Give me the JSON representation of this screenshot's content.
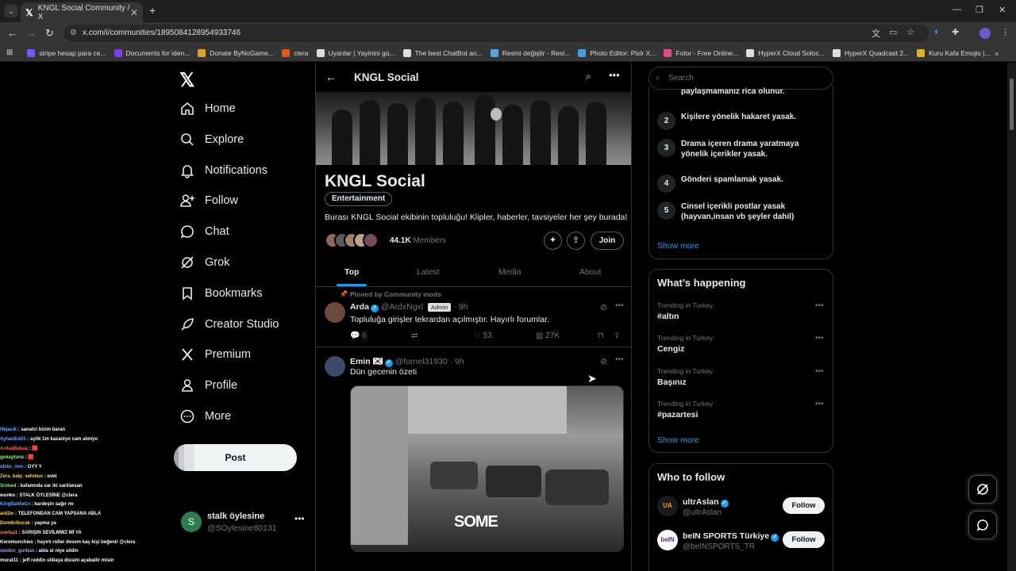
{
  "browser": {
    "tab_title": "KNGL Social Community / X",
    "url": "x.com/i/communities/1895084128954933746",
    "bookmarks": [
      {
        "label": "stripe hesap para ce...",
        "color": "#6a5cff"
      },
      {
        "label": "Documents for iden...",
        "color": "#7b3fe4"
      },
      {
        "label": "Donate ByNoGame...",
        "color": "#e0a030"
      },
      {
        "label": "clera",
        "color": "#e05a20"
      },
      {
        "label": "Uyanlar | Yayinini gü...",
        "color": "#dddddd"
      },
      {
        "label": "The best ChatBot an...",
        "color": "#dddddd"
      },
      {
        "label": "Resmi değiştir - Resi...",
        "color": "#5aa0e0"
      },
      {
        "label": "Photo Editor: Pixlr X...",
        "color": "#3fa0e0"
      },
      {
        "label": "Fotor - Free Online...",
        "color": "#e04a8a"
      },
      {
        "label": "HyperX Cloud Soloc...",
        "color": "#dddddd"
      },
      {
        "label": "HyperX Quadcast 2...",
        "color": "#dddddd"
      },
      {
        "label": "Kuru Kafa Emojis |...",
        "color": "#e0b030"
      }
    ]
  },
  "sidebar": {
    "items": [
      {
        "label": "Home",
        "icon": "home-icon"
      },
      {
        "label": "Explore",
        "icon": "search-icon"
      },
      {
        "label": "Notifications",
        "icon": "bell-icon"
      },
      {
        "label": "Follow",
        "icon": "add-person-icon"
      },
      {
        "label": "Chat",
        "icon": "chat-icon"
      },
      {
        "label": "Grok",
        "icon": "grok-icon"
      },
      {
        "label": "Bookmarks",
        "icon": "bookmark-icon"
      },
      {
        "label": "Creator Studio",
        "icon": "rocket-icon"
      },
      {
        "label": "Premium",
        "icon": "x-logo-icon"
      },
      {
        "label": "Profile",
        "icon": "person-icon"
      },
      {
        "label": "More",
        "icon": "more-circle-icon"
      }
    ],
    "post_label": "Post",
    "account": {
      "initial": "S",
      "name": "stalk öylesine",
      "handle": "@SOylesine80131"
    }
  },
  "chat_overlay": [
    {
      "user": "Hejacik",
      "color": "#5ab0ff",
      "msg": " : sanatci bizim baran"
    },
    {
      "user": "AyhanEdit1",
      "color": "#6ea6ff",
      "msg": " : aylik 1m kazaniyo cam almiyo"
    },
    {
      "user": "ArdaaBabaa",
      "color": "#ff5a5a",
      "msg": " : 🟥"
    },
    {
      "user": "gokaytuna",
      "color": "#7aff7a",
      "msg": " : 🟥"
    },
    {
      "user": "obito_rinn",
      "color": "#6ea6ff",
      "msg": " : OYY Y"
    },
    {
      "user": "Zera_kalp_sehmus",
      "color": "#ffd24a",
      "msg": " : evet"
    },
    {
      "user": "Srimed",
      "color": "#7aff7a",
      "msg": " : kafamnda var iki sarilsesan"
    },
    {
      "user": "wunko",
      "color": "#ffffff",
      "msg": " : STALK ÖYLESİNE @clera"
    },
    {
      "user": "KingBaldw1n",
      "color": "#6ea6ff",
      "msg": " : kardeşin sağır mı"
    },
    {
      "user": "ard2w",
      "color": "#ffd24a",
      "msg": " : TELEFONDAN CAM YAPSANA ABLA"
    },
    {
      "user": "Dom6cIburak",
      "color": "#ffd24a",
      "msg": " : yapma ya"
    },
    {
      "user": "ssefaa1",
      "color": "#ff8a4a",
      "msg": " : SARIŞIN SEVİLMWZ Mİ YA"
    },
    {
      "user": "Keromunchies",
      "color": "#ffffff",
      "msg": " : hayırlı roller desem kaç kişi beğenir @clera"
    },
    {
      "user": "umdov_gurban",
      "color": "#c78aff",
      "msg": " : abla st niye sildin"
    },
    {
      "user": "murat11",
      "color": "#ffffff",
      "msg": " : jeff reddin stillaya dissini açabailir misin"
    }
  ],
  "community": {
    "header_title": "KNGL Social",
    "name": "KNGL Social",
    "category": "Entertainment",
    "description": "Burası KNGL Social ekibinin topluluğu! Klipler, haberler, tavsiyeler her şey burada!",
    "members_count": "44.1K",
    "members_label": "Members",
    "join_label": "Join",
    "tabs": [
      "Top",
      "Latest",
      "Media",
      "About"
    ]
  },
  "posts": [
    {
      "pinned_label": "Pinned by Community mods",
      "name": "Arda",
      "handle": "@ArdxNgxl",
      "badge": "Admin",
      "time": "· 9h",
      "text": "Topluluğa girişler tekrardan açılmıştır. Hayırlı forumlar.",
      "replies": "6",
      "likes": "53",
      "views": "27K"
    },
    {
      "name": "Emin 🇰🇷",
      "handle": "@fornel31930",
      "time": "· 9h",
      "text": "Dün gecenin özeti",
      "media_watermark": "SOME"
    }
  ],
  "right": {
    "search_placeholder": "Search",
    "rules_partial": "paylaşmamanız rica olunur.",
    "rules": [
      {
        "n": "2",
        "text": "Kişilere yönelik hakaret yasak."
      },
      {
        "n": "3",
        "text": "Drama içeren drama yaratmaya yönelik içerikler yasak."
      },
      {
        "n": "4",
        "text": "Gönderi spamlamak yasak."
      },
      {
        "n": "5",
        "text": "Cinsel içerikli postlar yasak (hayvan,insan vb şeyler dahil)"
      }
    ],
    "show_more": "Show more",
    "happening_title": "What’s happening",
    "trends": [
      {
        "meta": "Trending in Turkey",
        "name": "#altın"
      },
      {
        "meta": "Trending in Turkey",
        "name": "Cengiz"
      },
      {
        "meta": "Trending in Turkey",
        "name": "Başınız"
      },
      {
        "meta": "Trending in Turkey",
        "name": "#pazartesi"
      }
    ],
    "follow_title": "Who to follow",
    "follow": [
      {
        "name": "ultrAslan",
        "handle": "@ultrAslan",
        "logo": "UA",
        "btn": "Follow"
      },
      {
        "name": "beIN SPORTS Türkiye",
        "handle": "@beINSPORTS_TR",
        "logo": "beIN",
        "btn": "Follow"
      }
    ]
  }
}
